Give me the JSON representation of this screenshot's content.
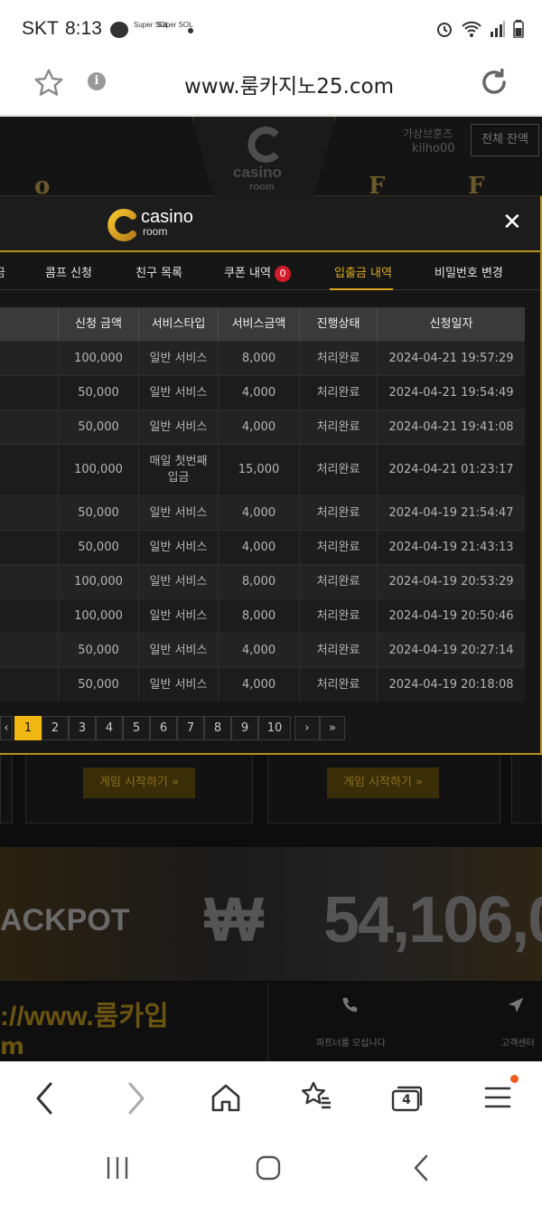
{
  "status_bar": {
    "carrier": "SKT",
    "time": "8:13",
    "sol_badges": [
      "Super SOL",
      "Super SOL"
    ]
  },
  "browser": {
    "url": "www.룸카지노25.com",
    "info_glyph": "i",
    "tab_count": "4",
    "icons": {
      "bookmark": "star-outline",
      "info": "info-circle",
      "reload": "reload",
      "back": "chevron-left",
      "forward": "chevron-right",
      "home": "home",
      "bookmarks": "star-list",
      "tabs": "tabs",
      "menu": "hamburger"
    }
  },
  "background_page": {
    "logo_text": "casino",
    "logo_sub": "room",
    "vu_label": "가상브훈즈",
    "username": "kilho00",
    "balance_button": "전체 잔액",
    "game_buttons": [
      "게임 시작하기 »",
      "게임 시작하기 »"
    ],
    "jackpot_label": "ACKPOT",
    "jackpot_currency": "₩",
    "jackpot_amount": "54,106,0",
    "bottom_url": "://www.룸카입",
    "bottom_m": "m",
    "partner_label": "파트너를 모십니다",
    "cs_label": "고객센터"
  },
  "modal": {
    "logo_text": "casino",
    "logo_sub": "room",
    "close_glyph": "✕",
    "tabs": [
      {
        "label": "콤프 신청",
        "active": false
      },
      {
        "label": "친구 목록",
        "active": false
      },
      {
        "label": "쿠폰 내역",
        "badge": "0",
        "active": false
      },
      {
        "label": "입출금 내역",
        "active": true
      },
      {
        "label": "비밀번호 변경",
        "active": false
      }
    ],
    "table": {
      "headers": [
        "신청 금액",
        "서비스타입",
        "서비스금액",
        "진행상태",
        "신청일자"
      ],
      "rows": [
        {
          "amount": "100,000",
          "type": "일반 서비스",
          "service": "8,000",
          "status": "처리완료",
          "date": "2024-04-21 19:57:29"
        },
        {
          "amount": "50,000",
          "type": "일반 서비스",
          "service": "4,000",
          "status": "처리완료",
          "date": "2024-04-21 19:54:49"
        },
        {
          "amount": "50,000",
          "type": "일반 서비스",
          "service": "4,000",
          "status": "처리완료",
          "date": "2024-04-21 19:41:08"
        },
        {
          "amount": "100,000",
          "type": "매일 첫번째\n입금",
          "service": "15,000",
          "status": "처리완료",
          "date": "2024-04-21 01:23:17"
        },
        {
          "amount": "50,000",
          "type": "일반 서비스",
          "service": "4,000",
          "status": "처리완료",
          "date": "2024-04-19 21:54:47"
        },
        {
          "amount": "50,000",
          "type": "일반 서비스",
          "service": "4,000",
          "status": "처리완료",
          "date": "2024-04-19 21:43:13"
        },
        {
          "amount": "100,000",
          "type": "일반 서비스",
          "service": "8,000",
          "status": "처리완료",
          "date": "2024-04-19 20:53:29"
        },
        {
          "amount": "100,000",
          "type": "일반 서비스",
          "service": "8,000",
          "status": "처리완료",
          "date": "2024-04-19 20:50:46"
        },
        {
          "amount": "50,000",
          "type": "일반 서비스",
          "service": "4,000",
          "status": "처리완료",
          "date": "2024-04-19 20:27:14"
        },
        {
          "amount": "50,000",
          "type": "일반 서비스",
          "service": "4,000",
          "status": "처리완료",
          "date": "2024-04-19 20:18:08"
        }
      ]
    },
    "pagination": {
      "prev": "‹",
      "pages": [
        "1",
        "2",
        "3",
        "4",
        "5",
        "6",
        "7",
        "8",
        "9",
        "10"
      ],
      "current": "1",
      "next": "›",
      "last": "»"
    }
  },
  "colors": {
    "accent": "#e0a91a",
    "active_page": "#f1b712",
    "badge": "#d11a2a",
    "header_row": "#3a3a3a"
  }
}
